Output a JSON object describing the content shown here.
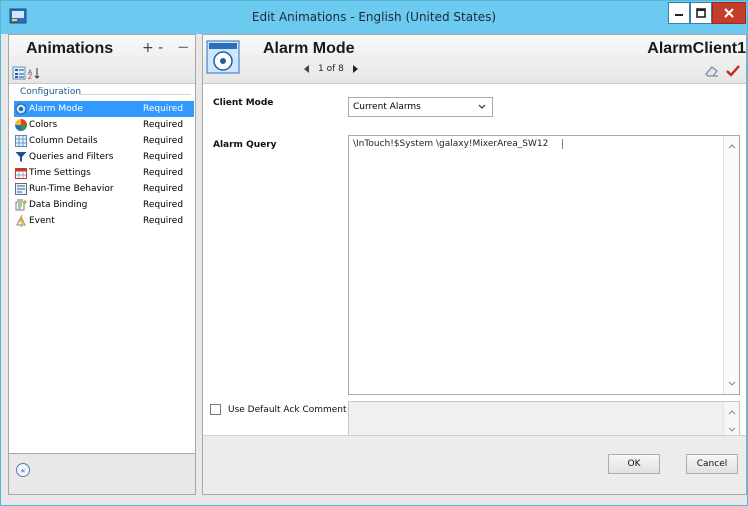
{
  "window": {
    "title": "Edit Animations - English (United States)"
  },
  "left": {
    "heading": "Animations",
    "add_glyph": "+ -",
    "remove_glyph": "−",
    "section": "Configuration",
    "items": [
      {
        "label": "Alarm Mode",
        "status": "Required",
        "icon": "alarm-mode-icon",
        "selected": true
      },
      {
        "label": "Colors",
        "status": "Required",
        "icon": "colors-icon",
        "selected": false
      },
      {
        "label": "Column Details",
        "status": "Required",
        "icon": "column-details-icon",
        "selected": false
      },
      {
        "label": "Queries and Filters",
        "status": "Required",
        "icon": "filter-icon",
        "selected": false
      },
      {
        "label": "Time Settings",
        "status": "Required",
        "icon": "time-settings-icon",
        "selected": false
      },
      {
        "label": "Run-Time Behavior",
        "status": "Required",
        "icon": "runtime-behavior-icon",
        "selected": false
      },
      {
        "label": "Data Binding",
        "status": "Required",
        "icon": "data-binding-icon",
        "selected": false
      },
      {
        "label": "Event",
        "status": "Required",
        "icon": "event-icon",
        "selected": false
      }
    ],
    "collapse_glyph": "«"
  },
  "right": {
    "title": "Alarm Mode",
    "pager": "1 of 8",
    "object_name": "AlarmClient1",
    "client_mode_label": "Client Mode",
    "client_mode_value": "Current Alarms",
    "alarm_query_label": "Alarm Query",
    "alarm_query_value": "\\InTouch!$System \\galaxy!MixerArea_SW12",
    "ack_label": "Use Default Ack Comment",
    "ok_label": "OK",
    "cancel_label": "Cancel"
  },
  "colors": {
    "titlebar": "#6ccaf0",
    "selection": "#3399ff",
    "close": "#c43c2c",
    "check": "#cc2222"
  }
}
